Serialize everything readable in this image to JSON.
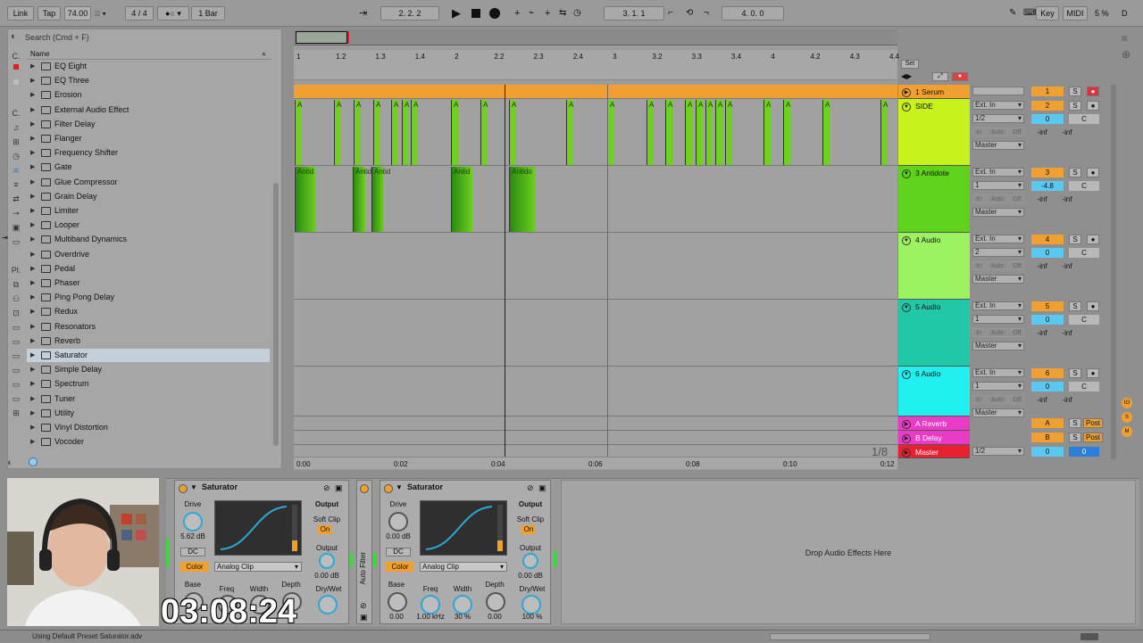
{
  "transport": {
    "link": "Link",
    "tap": "Tap",
    "tempo": "74.00",
    "time_sig_num": "4",
    "time_sig_den": "4",
    "quantize": "1 Bar",
    "position": "2.   2.   2",
    "loop_start": "3.   1.   1",
    "loop_length": "4.   0.   0",
    "key": "Key",
    "midi": "MIDI",
    "cpu": "5 %",
    "disk": "D"
  },
  "browser": {
    "search_placeholder": "Search (Cmd + F)",
    "name_header": "Name",
    "categories": [
      "C.",
      "Pl."
    ],
    "items": [
      {
        "label": "EQ Eight",
        "selected": false
      },
      {
        "label": "EQ Three",
        "selected": false
      },
      {
        "label": "Erosion",
        "selected": false
      },
      {
        "label": "External Audio Effect",
        "selected": false
      },
      {
        "label": "Filter Delay",
        "selected": false
      },
      {
        "label": "Flanger",
        "selected": false
      },
      {
        "label": "Frequency Shifter",
        "selected": false
      },
      {
        "label": "Gate",
        "selected": false
      },
      {
        "label": "Glue Compressor",
        "selected": false
      },
      {
        "label": "Grain Delay",
        "selected": false
      },
      {
        "label": "Limiter",
        "selected": false
      },
      {
        "label": "Looper",
        "selected": false
      },
      {
        "label": "Multiband Dynamics",
        "selected": false
      },
      {
        "label": "Overdrive",
        "selected": false
      },
      {
        "label": "Pedal",
        "selected": false
      },
      {
        "label": "Phaser",
        "selected": false
      },
      {
        "label": "Ping Pong Delay",
        "selected": false
      },
      {
        "label": "Redux",
        "selected": false
      },
      {
        "label": "Resonators",
        "selected": false
      },
      {
        "label": "Reverb",
        "selected": false
      },
      {
        "label": "Saturator",
        "selected": true
      },
      {
        "label": "Simple Delay",
        "selected": false
      },
      {
        "label": "Spectrum",
        "selected": false
      },
      {
        "label": "Tuner",
        "selected": false
      },
      {
        "label": "Utility",
        "selected": false
      },
      {
        "label": "Vinyl Distortion",
        "selected": false
      },
      {
        "label": "Vocoder",
        "selected": false
      }
    ]
  },
  "ruler": {
    "bars": [
      "1",
      "1.2",
      "1.3",
      "1.4",
      "2",
      "2.2",
      "2.3",
      "2.4",
      "3",
      "3.2",
      "3.3",
      "3.4",
      "4",
      "4.2",
      "4.3",
      "4.4"
    ],
    "times": [
      "0:00",
      "0:02",
      "0:04",
      "0:06",
      "0:08",
      "0:10",
      "0:12"
    ],
    "set_label": "Set",
    "zoom": "1/8"
  },
  "tracks": [
    {
      "name": "1 Serum",
      "color": "#f0a030",
      "input": "",
      "channel": "",
      "number": "1",
      "vol": "",
      "pan": ""
    },
    {
      "name": "SIDE",
      "color": "#c8f21c",
      "input": "Ext. In",
      "channel": "1/2",
      "number": "2",
      "vol": "0",
      "pan": "C",
      "send_a": "-inf",
      "send_b": "-inf",
      "output": "Master"
    },
    {
      "name": "3 Antidote",
      "color": "#5fd21c",
      "input": "Ext. In",
      "channel": "1",
      "number": "3",
      "vol": "-4.8",
      "pan": "C",
      "send_a": "-inf",
      "send_b": "-inf",
      "output": "Master"
    },
    {
      "name": "4 Audio",
      "color": "#9cf261",
      "input": "Ext. In",
      "channel": "2",
      "number": "4",
      "vol": "0",
      "pan": "C",
      "send_a": "-inf",
      "send_b": "-inf",
      "output": "Master"
    },
    {
      "name": "5 Audio",
      "color": "#20c8a8",
      "input": "Ext. In",
      "channel": "1",
      "number": "5",
      "vol": "0",
      "pan": "C",
      "send_a": "-inf",
      "send_b": "-inf",
      "output": "Master"
    },
    {
      "name": "6 Audio",
      "color": "#20f0f0",
      "input": "Ext. In",
      "channel": "1",
      "number": "6",
      "vol": "0",
      "pan": "C",
      "send_a": "-inf",
      "send_b": "-inf",
      "output": "Master"
    }
  ],
  "monitor": {
    "in": "In",
    "auto": "Auto",
    "off": "Off"
  },
  "returns": [
    {
      "name": "A Reverb",
      "letter": "A",
      "color": "#e83cc8",
      "post": "Post"
    },
    {
      "name": "B Delay",
      "letter": "B",
      "color": "#e83cc8",
      "post": "Post"
    }
  ],
  "master": {
    "name": "Master",
    "color": "#e82030",
    "channel": "1/2",
    "vol": "0",
    "pan": "0"
  },
  "clips": {
    "side_label": "A",
    "antidote_label": "Antid",
    "antidote_label2": "Antido"
  },
  "devices": [
    {
      "title": "Saturator",
      "drive_label": "Drive",
      "drive_value": "5.62 dB",
      "output_label": "Output",
      "soft_clip": "Soft Clip",
      "on": "On",
      "output_knob_label": "Output",
      "output_value": "0.00 dB",
      "dc": "DC",
      "color": "Color",
      "mode": "Analog Clip",
      "base": "Base",
      "freq": "Freq",
      "width": "Width",
      "depth": "Depth",
      "drywet": "Dry/Wet"
    },
    {
      "title": "Saturator",
      "drive_label": "Drive",
      "drive_value": "0.00 dB",
      "output_label": "Output",
      "soft_clip": "Soft Clip",
      "on": "On",
      "output_knob_label": "Output",
      "output_value": "0.00 dB",
      "dc": "DC",
      "color": "Color",
      "mode": "Analog Clip",
      "base": "Base",
      "base_value": "0.00",
      "freq": "Freq",
      "freq_value": "1.00 kHz",
      "width": "Width",
      "width_value": "30 %",
      "depth": "Depth",
      "depth_value": "0.00",
      "drywet": "Dry/Wet",
      "drywet_value": "100 %"
    }
  ],
  "auto_filter_label": "Auto Filter",
  "drop_hint": "Drop Audio Effects Here",
  "overlay_timer": "03:08:24",
  "status_text": "Using Default Preset Saturator.adv"
}
